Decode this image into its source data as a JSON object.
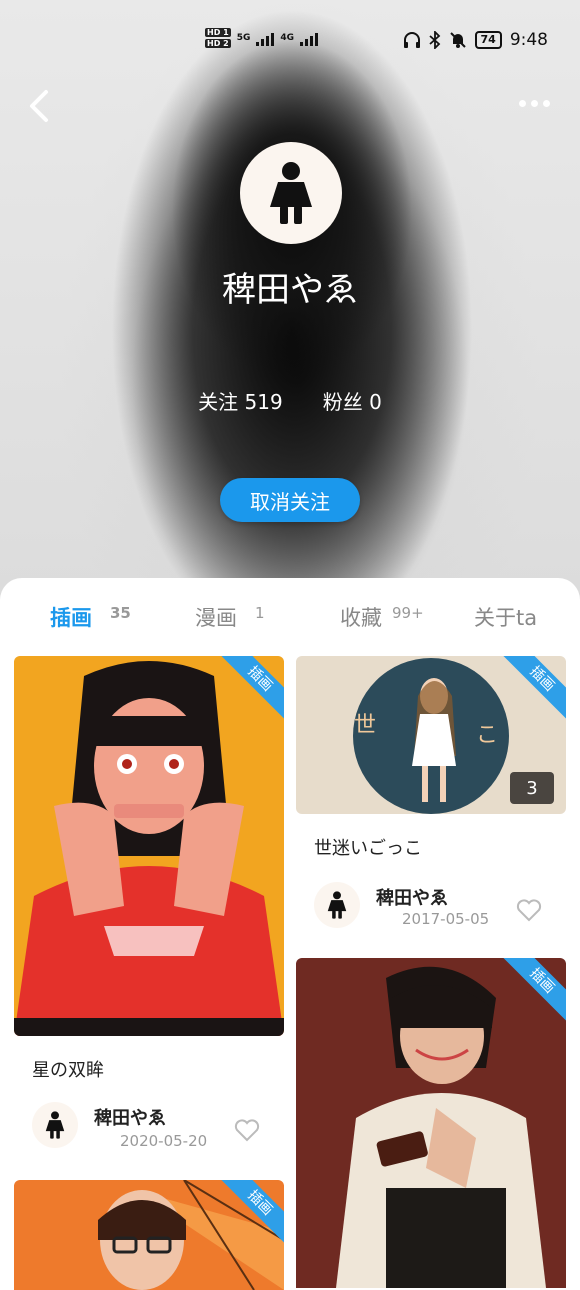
{
  "status_bar": {
    "time": "9:48",
    "battery": "74",
    "hd1": "HD 1",
    "hd2": "HD 2",
    "net1": "5G",
    "net2": "4G"
  },
  "profile": {
    "name": "稗田やゑ",
    "follow_label": "关注",
    "follow_count": "519",
    "fans_label": "粉丝",
    "fans_count": "0",
    "unfollow_label": "取消关注"
  },
  "tabs": [
    {
      "label": "插画",
      "count": "35"
    },
    {
      "label": "漫画",
      "count": "1"
    },
    {
      "label": "收藏",
      "count": "99+"
    },
    {
      "label": "关于ta",
      "count": ""
    }
  ],
  "cards": [
    {
      "title": "星の双眸",
      "author": "稗田やゑ",
      "date": "2020-05-20",
      "tag": "插画",
      "page_count": ""
    },
    {
      "title": "世迷いごっこ",
      "author": "稗田やゑ",
      "date": "2017-05-05",
      "tag": "插画",
      "page_count": "3"
    },
    {
      "title": "",
      "author": "",
      "date": "",
      "tag": "插画",
      "page_count": ""
    },
    {
      "title": "",
      "author": "",
      "date": "",
      "tag": "插画",
      "page_count": ""
    }
  ],
  "colors": {
    "accent": "#1b98ec"
  },
  "icons": {
    "back": "chevron-left-icon",
    "more": "more-dots-icon",
    "avatar": "person-silhouette-icon",
    "like": "heart-outline-icon"
  }
}
